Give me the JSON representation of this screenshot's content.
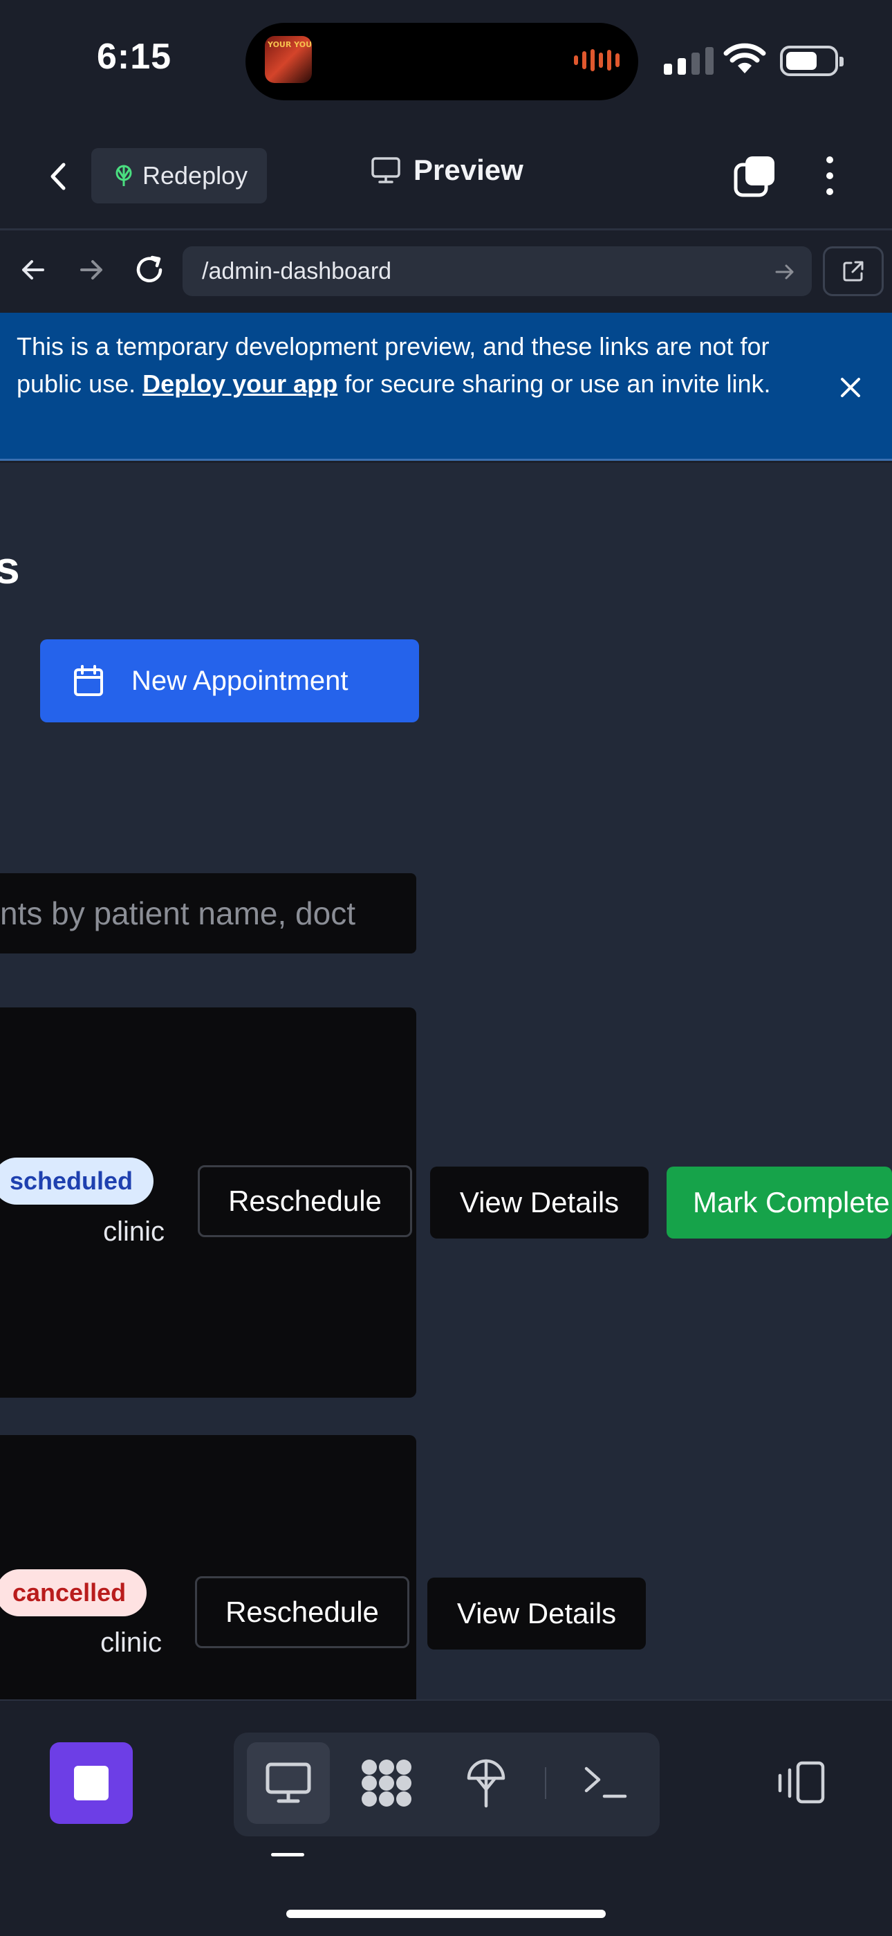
{
  "status": {
    "time": "6:15",
    "album_art_text": "YOUR YOU"
  },
  "topbar": {
    "redeploy_label": "Redeploy",
    "preview_label": "Preview"
  },
  "browser": {
    "url": "/admin-dashboard"
  },
  "banner": {
    "text_before": "This is a temporary development preview, and these links are not for public use.",
    "link_text": "Deploy your app",
    "text_after": "for secure sharing or use an invite link."
  },
  "page": {
    "heading_fragment": "s",
    "new_appointment_label": "New Appointment",
    "search_placeholder": "nts by patient name, doct"
  },
  "appointments": [
    {
      "status": "scheduled",
      "location": "clinic",
      "actions": {
        "reschedule": "Reschedule",
        "view": "View Details",
        "complete": "Mark Complete"
      }
    },
    {
      "status": "cancelled",
      "location": "clinic",
      "actions": {
        "reschedule": "Reschedule",
        "view": "View Details"
      }
    }
  ],
  "colors": {
    "primary": "#2563eb",
    "success": "#16a34a",
    "banner": "#03488e",
    "stop": "#6d3ee6",
    "scheduled_badge_bg": "#dbeafe",
    "cancelled_badge_bg": "#fee2e2"
  },
  "icons": {
    "toolbar": [
      "desktop-icon",
      "apps-icon",
      "deploy-icon",
      "terminal-icon"
    ],
    "device": "devices-icon"
  }
}
